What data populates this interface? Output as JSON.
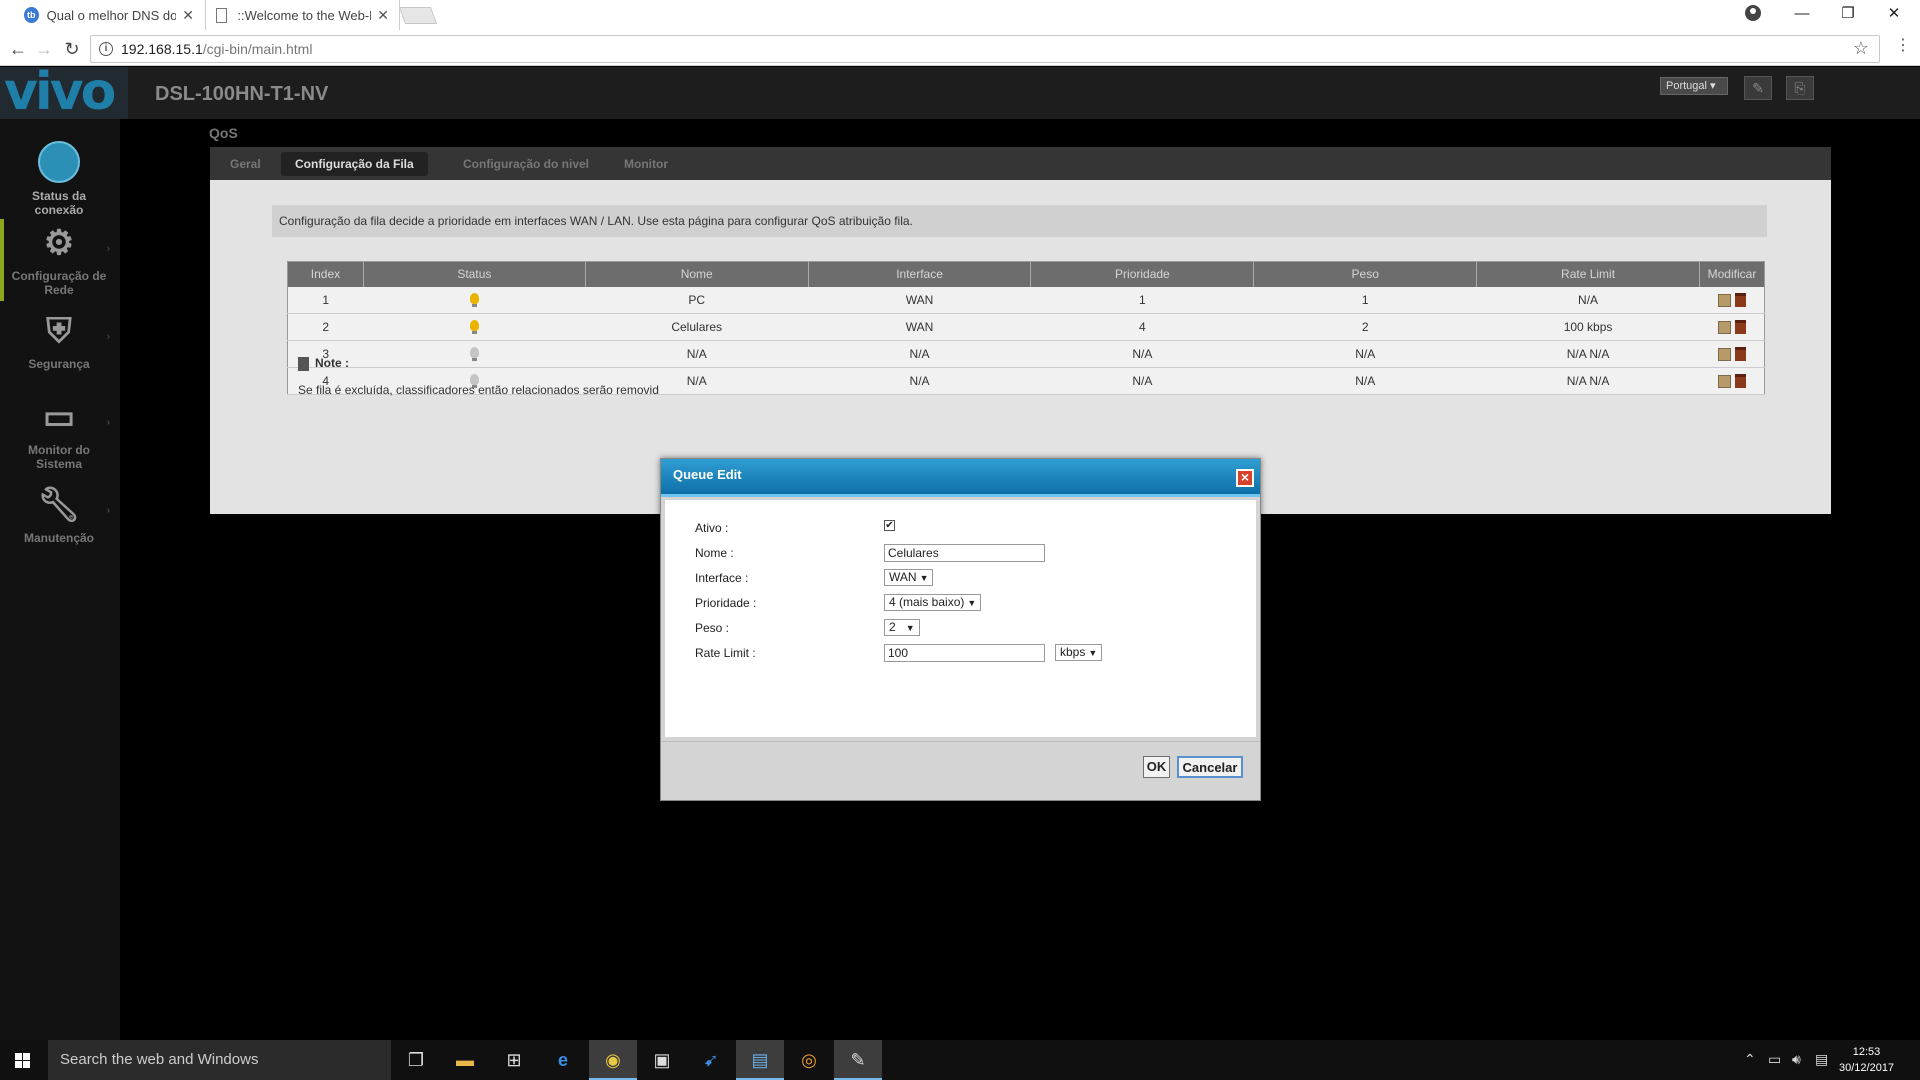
{
  "browser": {
    "tabs": [
      {
        "title": "Qual o melhor DNS do B",
        "icon": "tb-favicon-icon",
        "favicon_text": "tb"
      },
      {
        "title": "::Welcome to the Web-B",
        "icon": "page-icon"
      }
    ],
    "url_host": "192.168.15.1",
    "url_path": "/cgi-bin/main.html"
  },
  "router": {
    "logo": "vivo",
    "model": "DSL-100HN-T1-NV",
    "language": "Portugal",
    "section_title": "QoS",
    "sidebar": [
      {
        "label_line1": "Status da",
        "label_line2": "conexão",
        "icon": "globe-icon"
      },
      {
        "label_line1": "Configuração de",
        "label_line2": "Rede",
        "icon": "gears-icon"
      },
      {
        "label_line1": "Segurança",
        "label_line2": "",
        "icon": "shield-icon"
      },
      {
        "label_line1": "Monitor do",
        "label_line2": "Sistema",
        "icon": "monitor-icon"
      },
      {
        "label_line1": "Manutenção",
        "label_line2": "",
        "icon": "wrench-icon"
      }
    ],
    "tabs": [
      "Geral",
      "Configuração da Fila",
      "Configuração do nivel",
      "Monitor"
    ],
    "active_tab": "Configuração da Fila",
    "description": "Configuração da fila decide a prioridade em interfaces WAN / LAN. Use esta página para configurar QoS atribuição fila.",
    "table": {
      "headers": [
        "Index",
        "Status",
        "Nome",
        "Interface",
        "Prioridade",
        "Peso",
        "Rate Limit",
        "Modificar"
      ],
      "rows": [
        {
          "index": "1",
          "status": "on",
          "nome": "PC",
          "interface": "WAN",
          "prioridade": "1",
          "peso": "1",
          "rate_limit": "N/A"
        },
        {
          "index": "2",
          "status": "on",
          "nome": "Celulares",
          "interface": "WAN",
          "prioridade": "4",
          "peso": "2",
          "rate_limit": "100 kbps"
        },
        {
          "index": "3",
          "status": "off",
          "nome": "N/A",
          "interface": "N/A",
          "prioridade": "N/A",
          "peso": "N/A",
          "rate_limit": "N/A N/A"
        },
        {
          "index": "4",
          "status": "off",
          "nome": "N/A",
          "interface": "N/A",
          "prioridade": "N/A",
          "peso": "N/A",
          "rate_limit": "N/A N/A"
        }
      ]
    },
    "note_title": "Note :",
    "note_text": "Se fila é excluída, classificadores então relacionados serão removid"
  },
  "modal": {
    "title": "Queue Edit",
    "fields": {
      "ativo_label": "Ativo :",
      "ativo_checked": true,
      "nome_label": "Nome :",
      "nome_value": "Celulares",
      "interface_label": "Interface :",
      "interface_value": "WAN",
      "prioridade_label": "Prioridade :",
      "prioridade_value": "4 (mais baixo)",
      "peso_label": "Peso :",
      "peso_value": "2",
      "rate_label": "Rate Limit :",
      "rate_value": "100",
      "rate_unit": "kbps"
    },
    "ok_label": "OK",
    "cancel_label": "Cancelar"
  },
  "taskbar": {
    "search_placeholder": "Search the web and Windows",
    "time": "12:53",
    "date": "30/12/2017"
  },
  "colors": {
    "modal_title_bg": "#1a86c0",
    "bulb_on": "#e9b400",
    "bulb_off": "#c5c5c5",
    "logo": "#1f7fa8"
  }
}
